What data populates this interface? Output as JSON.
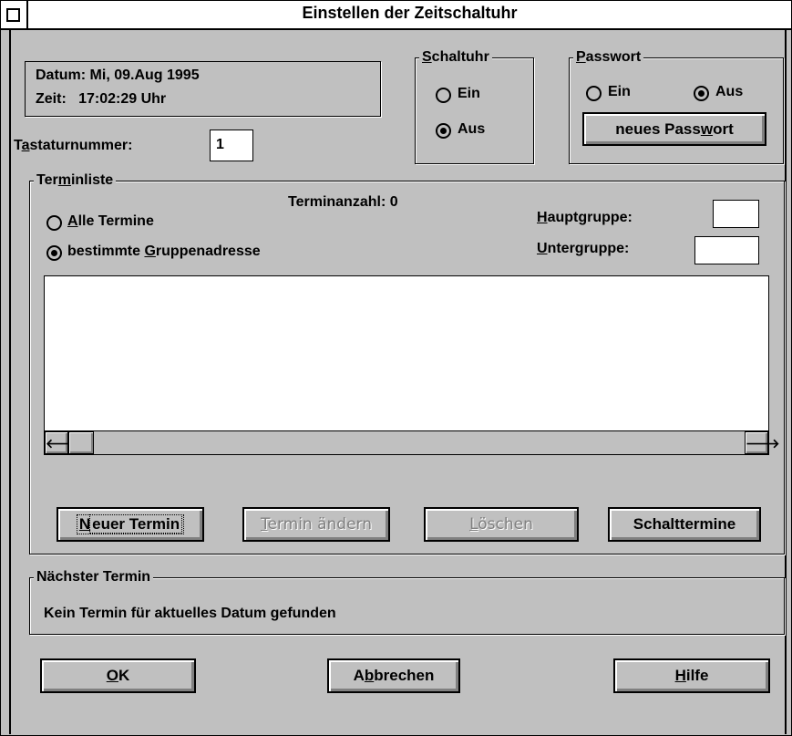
{
  "window": {
    "title": "Einstellen der Zeitschaltuhr"
  },
  "datetime": {
    "date": "Datum: Mi, 09.Aug 1995",
    "time": "Zeit:   17:02:29 Uhr"
  },
  "keyboard": {
    "label_pre": "T",
    "label_ul": "a",
    "label_post": "staturnummer:",
    "value": "1"
  },
  "schaltuhr": {
    "label_ul": "S",
    "label_post": "chaltuhr",
    "on": "Ein",
    "off": "Aus",
    "selected": "Aus"
  },
  "passwort": {
    "label_ul": "P",
    "label_post": "asswort",
    "on": "Ein",
    "off": "Aus",
    "selected": "Aus",
    "new_pre": "neues Pass",
    "new_ul": "w",
    "new_post": "ort"
  },
  "terminliste": {
    "label_pre": "Ter",
    "label_ul": "m",
    "label_post": "inliste",
    "count_label": "Terminanzahl:  0",
    "all_ul": "A",
    "all_post": "lle Termine",
    "group_pre": "bestimmte ",
    "group_ul": "G",
    "group_post": "ruppenadresse",
    "selected": "bestimmte Gruppenadresse",
    "haupt_ul": "H",
    "haupt_post": "auptgruppe:",
    "unter_ul": "U",
    "unter_post": "ntergruppe:",
    "haupt_value": "",
    "unter_value": ""
  },
  "buttons": {
    "new_ul": "N",
    "new_post": "euer Termin",
    "edit_ul": "T",
    "edit_post": "ermin ändern",
    "delete_ul": "L",
    "delete_post": "öschen",
    "schalt": "Schalttermine",
    "ok_ul": "O",
    "ok_post": "K",
    "cancel_pre": "A",
    "cancel_ul": "b",
    "cancel_post": "brechen",
    "help_ul": "H",
    "help_post": "ilfe"
  },
  "next": {
    "label": "Nächster Termin",
    "text": "Kein Termin für aktuelles Datum gefunden"
  },
  "icons": {
    "left": "arrow-left-icon",
    "right": "arrow-right-icon",
    "sysmenu": "system-menu-icon"
  }
}
